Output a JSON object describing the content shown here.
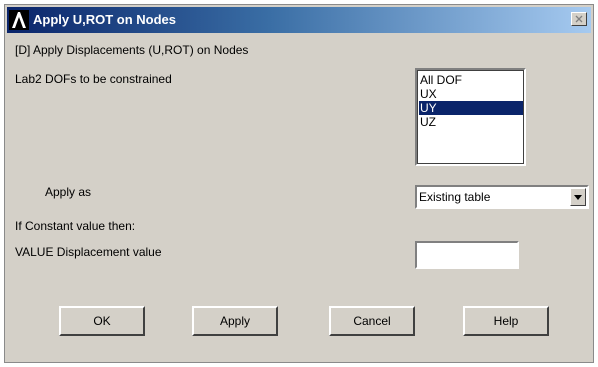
{
  "window": {
    "title": "Apply U,ROT on Nodes",
    "titlebar_color_start": "#0a246a",
    "titlebar_color_end": "#a6caf0",
    "logo_icon": "ansys-logo-icon",
    "close_icon": "close-icon"
  },
  "header": {
    "description": "[D]  Apply Displacements (U,ROT) on Nodes"
  },
  "lab2": {
    "label": "Lab2    DOFs to be constrained",
    "items": [
      {
        "label": "All DOF",
        "selected": false
      },
      {
        "label": "UX",
        "selected": false
      },
      {
        "label": "UY",
        "selected": true
      },
      {
        "label": "UZ",
        "selected": false
      }
    ],
    "selection_color": "#0a246a"
  },
  "apply_as": {
    "label": "Apply as",
    "selected": "Existing table",
    "dropdown_icon": "chevron-down-icon"
  },
  "constant_note": "If Constant value then:",
  "value_field": {
    "label": "VALUE   Displacement value",
    "value": ""
  },
  "buttons": {
    "ok": "OK",
    "apply": "Apply",
    "cancel": "Cancel",
    "help": "Help"
  },
  "colors": {
    "dialog_bg": "#d4d0c8"
  }
}
